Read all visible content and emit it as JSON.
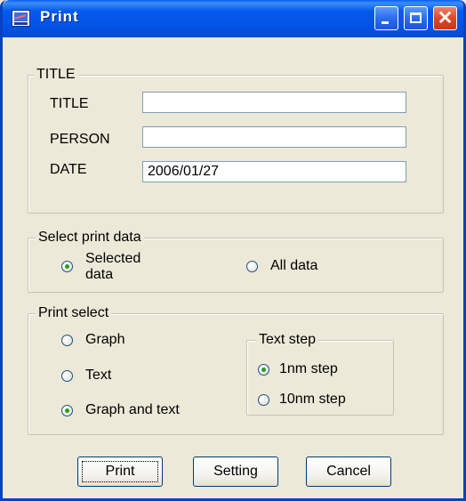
{
  "window": {
    "title": "Print",
    "controls": {
      "minimize": "minimize-icon",
      "maximize": "maximize-icon",
      "close": "close-icon"
    },
    "icon": "printer-app-icon"
  },
  "title_group": {
    "legend": "TITLE",
    "fields": [
      {
        "label": "TITLE",
        "value": ""
      },
      {
        "label": "PERSON",
        "value": ""
      },
      {
        "label": "DATE",
        "value": "2006/01/27"
      }
    ]
  },
  "select_print_data": {
    "legend": "Select print data",
    "options": [
      {
        "label_line1": "Selected",
        "label_line2": "data",
        "selected": true
      },
      {
        "label": "All data",
        "selected": false
      }
    ]
  },
  "print_select": {
    "legend": "Print select",
    "options": [
      {
        "label": "Graph",
        "selected": false
      },
      {
        "label": "Text",
        "selected": false
      },
      {
        "label": "Graph and text",
        "selected": true
      }
    ],
    "text_step": {
      "legend": "Text step",
      "options": [
        {
          "label": "1nm step",
          "selected": true
        },
        {
          "label": "10nm step",
          "selected": false
        }
      ]
    }
  },
  "buttons": {
    "print": "Print",
    "setting": "Setting",
    "cancel": "Cancel"
  },
  "colors": {
    "title_bar": "#0453E6",
    "dialog_bg": "#ECE9D8",
    "radio_dot": "#21A121",
    "close_button": "#E0472A"
  }
}
